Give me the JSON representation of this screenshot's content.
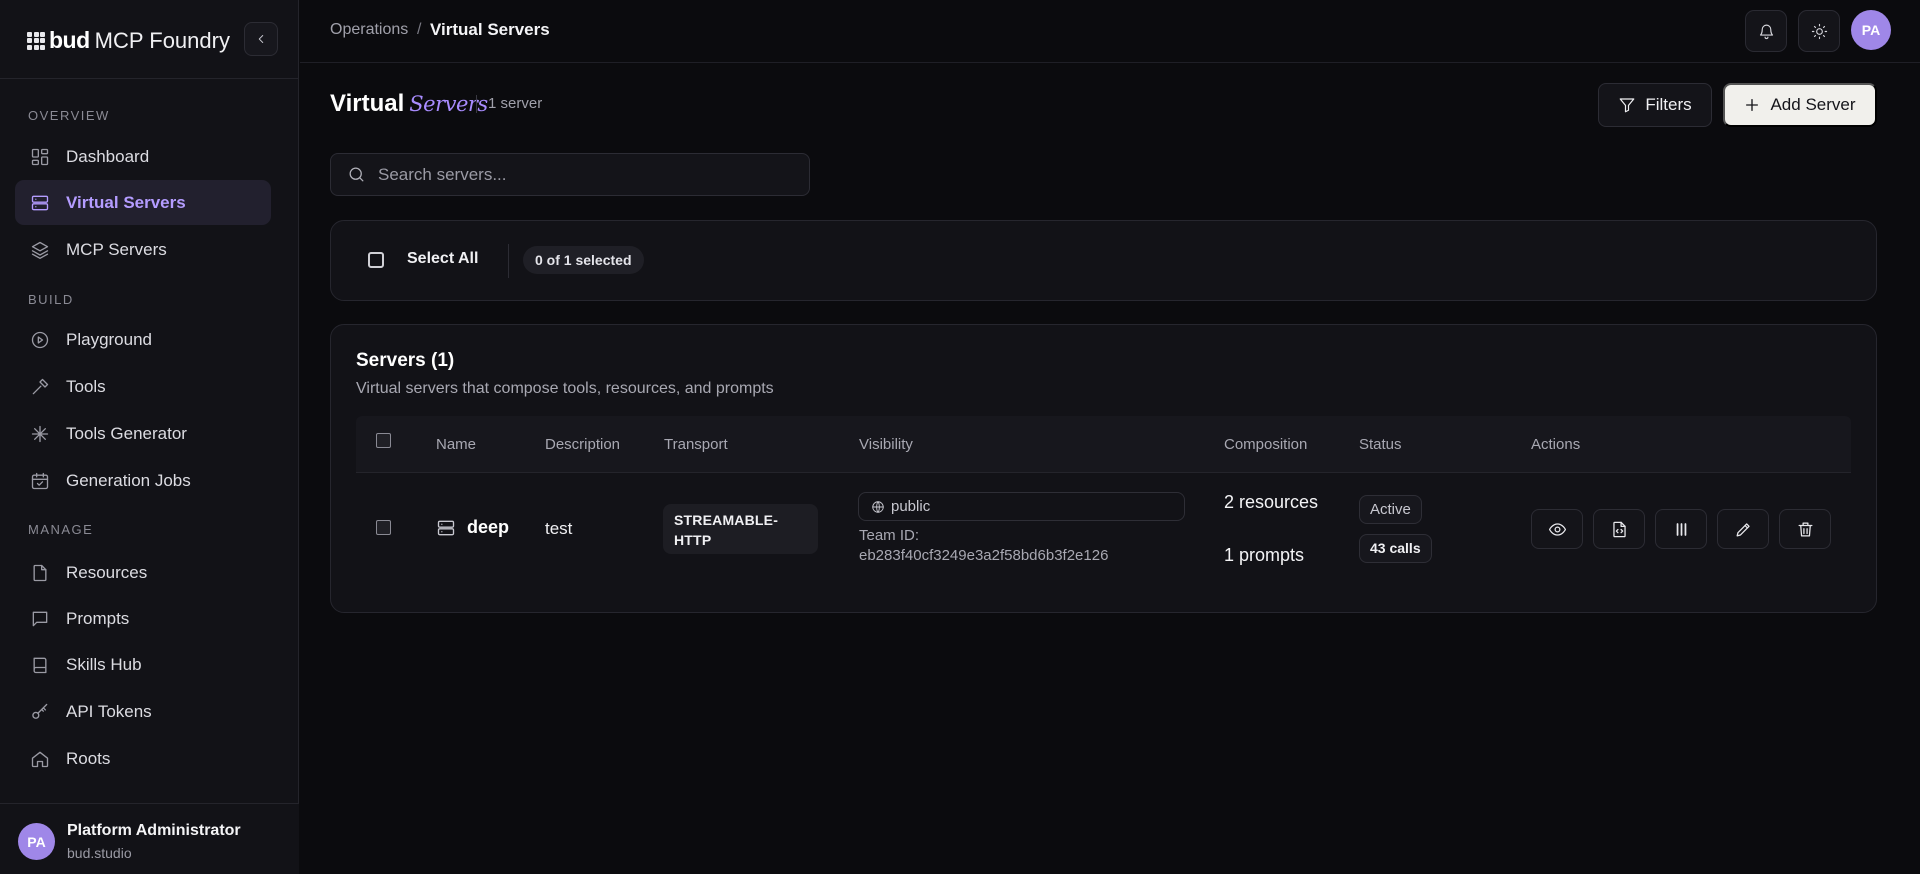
{
  "app": {
    "brand_bud": "bud",
    "brand_name": "MCP Foundry"
  },
  "sidebar": {
    "sections": [
      {
        "label": "OVERVIEW"
      },
      {
        "label": "BUILD"
      },
      {
        "label": "MANAGE"
      }
    ],
    "items": [
      {
        "label": "Dashboard",
        "icon": "grid-icon"
      },
      {
        "label": "Virtual Servers",
        "icon": "server-icon",
        "active": true
      },
      {
        "label": "MCP Servers",
        "icon": "layers-icon"
      },
      {
        "label": "Playground",
        "icon": "play-circle-icon"
      },
      {
        "label": "Tools",
        "icon": "hammer-icon"
      },
      {
        "label": "Tools Generator",
        "icon": "sparkle-icon"
      },
      {
        "label": "Generation Jobs",
        "icon": "calendar-check-icon"
      },
      {
        "label": "Resources",
        "icon": "file-icon"
      },
      {
        "label": "Prompts",
        "icon": "message-square-icon"
      },
      {
        "label": "Skills Hub",
        "icon": "book-icon"
      },
      {
        "label": "API Tokens",
        "icon": "key-icon"
      },
      {
        "label": "Roots",
        "icon": "home-icon"
      }
    ],
    "user": {
      "initials": "PA",
      "name": "Platform Administrator",
      "org": "bud.studio"
    }
  },
  "topbar": {
    "breadcrumb_parent": "Operations",
    "breadcrumb_sep": "/",
    "breadcrumb_current": "Virtual Servers",
    "avatar_initials": "PA"
  },
  "header": {
    "title_main": "Virtual",
    "title_accent": "Servers",
    "count": "1 server",
    "filters_label": "Filters",
    "add_label": "Add Server"
  },
  "search": {
    "placeholder": "Search servers..."
  },
  "selection": {
    "select_all_label": "Select All",
    "selected_count": "0 of 1 selected"
  },
  "servers_card": {
    "title": "Servers (1)",
    "description": "Virtual servers that compose tools, resources, and prompts",
    "columns": [
      "Name",
      "Description",
      "Transport",
      "Visibility",
      "Composition",
      "Status",
      "Actions"
    ],
    "rows": [
      {
        "name": "deep",
        "description": "test",
        "transport": "STREAMABLE-HTTP",
        "visibility": "public",
        "team_label": "Team ID:",
        "team_id": "eb283f40cf3249e3a2f58bd6b3f2e126",
        "resources": "2 resources",
        "prompts": "1 prompts",
        "status": "Active",
        "calls": "43 calls"
      }
    ]
  },
  "colors": {
    "accent": "#a98cff",
    "background": "#0b0b0e",
    "sidebar": "#121217",
    "primary_button": "#f1f0ec"
  }
}
